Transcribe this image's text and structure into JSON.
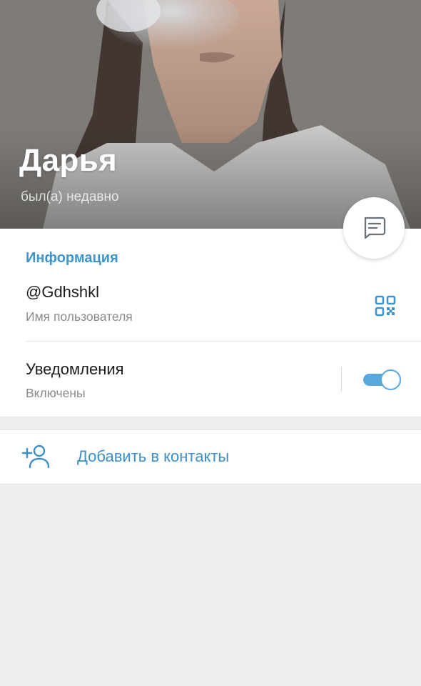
{
  "profile": {
    "name": "Дарья",
    "status": "был(а) недавно"
  },
  "info": {
    "section_title": "Информация",
    "username": "@Gdhshkl",
    "username_caption": "Имя пользователя",
    "notifications_label": "Уведомления",
    "notifications_caption": "Включены",
    "notifications_enabled": true
  },
  "actions": {
    "add_contact_label": "Добавить в контакты"
  },
  "icons": {
    "message": "message-icon",
    "qr": "qr-code-icon",
    "add_contact": "add-user-icon"
  },
  "colors": {
    "accent": "#3d95ce",
    "toggle_on": "#58a8de"
  }
}
